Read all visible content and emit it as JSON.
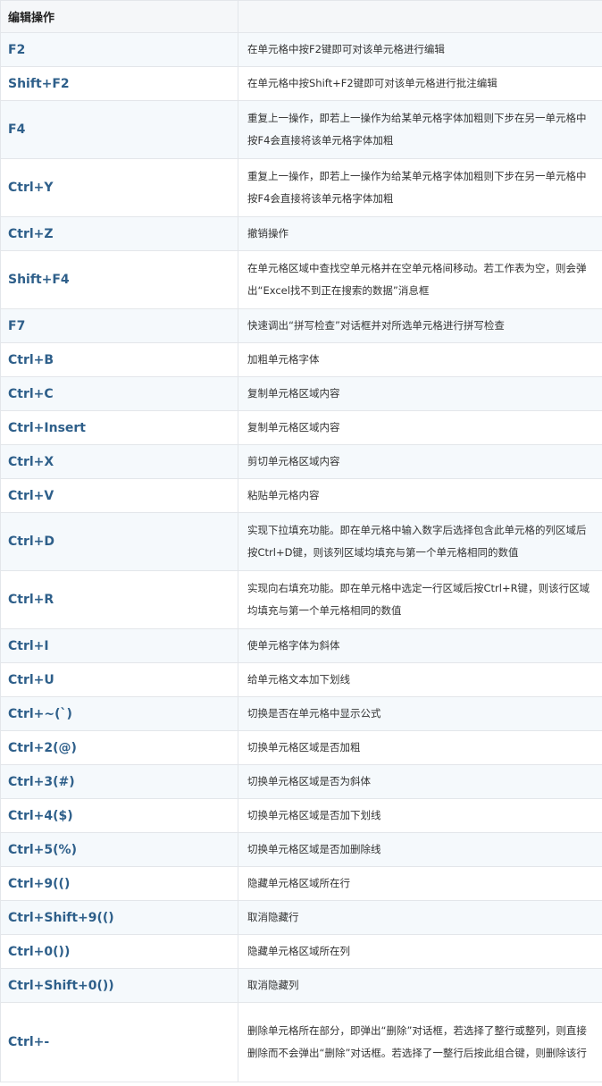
{
  "header": {
    "col1": "编辑操作",
    "col2": ""
  },
  "rows": [
    {
      "key": "F2",
      "desc": "在单元格中按F2键即可对该单元格进行编辑"
    },
    {
      "key": "Shift+F2",
      "desc": "在单元格中按Shift+F2键即可对该单元格进行批注编辑"
    },
    {
      "key": "F4",
      "desc": "重复上一操作，即若上一操作为给某单元格字体加粗则下步在另一单元格中按F4会直接将该单元格字体加粗"
    },
    {
      "key": "Ctrl+Y",
      "desc": "重复上一操作，即若上一操作为给某单元格字体加粗则下步在另一单元格中按F4会直接将该单元格字体加粗"
    },
    {
      "key": "Ctrl+Z",
      "desc": "撤销操作"
    },
    {
      "key": "Shift+F4",
      "desc": "在单元格区域中查找空单元格并在空单元格间移动。若工作表为空，则会弹出“Excel找不到正在搜索的数据”消息框"
    },
    {
      "key": "F7",
      "desc": "快速调出“拼写检查”对话框并对所选单元格进行拼写检查"
    },
    {
      "key": "Ctrl+B",
      "desc": "加粗单元格字体"
    },
    {
      "key": "Ctrl+C",
      "desc": "复制单元格区域内容"
    },
    {
      "key": "Ctrl+Insert",
      "desc": "复制单元格区域内容"
    },
    {
      "key": "Ctrl+X",
      "desc": "剪切单元格区域内容"
    },
    {
      "key": "Ctrl+V",
      "desc": "粘贴单元格内容"
    },
    {
      "key": "Ctrl+D",
      "desc": "实现下拉填充功能。即在单元格中输入数字后选择包含此单元格的列区域后按Ctrl+D键，则该列区域均填充与第一个单元格相同的数值"
    },
    {
      "key": "Ctrl+R",
      "desc": "实现向右填充功能。即在单元格中选定一行区域后按Ctrl+R键，则该行区域均填充与第一个单元格相同的数值"
    },
    {
      "key": "Ctrl+I",
      "desc": "使单元格字体为斜体"
    },
    {
      "key": "Ctrl+U",
      "desc": "给单元格文本加下划线"
    },
    {
      "key": "Ctrl+~(`)",
      "desc": "切换是否在单元格中显示公式"
    },
    {
      "key": "Ctrl+2(@)",
      "desc": "切换单元格区域是否加粗"
    },
    {
      "key": "Ctrl+3(#)",
      "desc": "切换单元格区域是否为斜体"
    },
    {
      "key": "Ctrl+4($)",
      "desc": "切换单元格区域是否加下划线"
    },
    {
      "key": "Ctrl+5(%)",
      "desc": "切换单元格区域是否加删除线"
    },
    {
      "key": "Ctrl+9(()",
      "desc": "隐藏单元格区域所在行"
    },
    {
      "key": "Ctrl+Shift+9(()",
      "desc": "取消隐藏行"
    },
    {
      "key": "Ctrl+0())",
      "desc": "隐藏单元格区域所在列"
    },
    {
      "key": "Ctrl+Shift+0())",
      "desc": "取消隐藏列"
    },
    {
      "key": "Ctrl+-",
      "desc": "删除单元格所在部分，即弹出“删除”对话框，若选择了整行或整列，则直接删除而不会弹出“删除”对话框。若选择了一整行后按此组合键，则删除该行"
    }
  ]
}
